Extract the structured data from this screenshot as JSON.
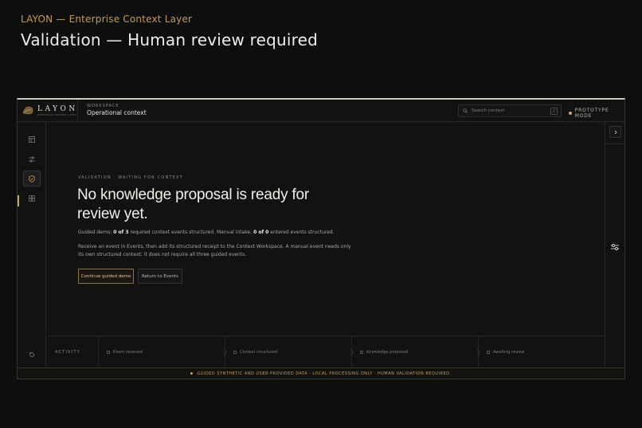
{
  "page": {
    "pretitle": "LAYON — Enterprise Context Layer",
    "title": "Validation — Human review required"
  },
  "topbar": {
    "brand_name": "LAYON",
    "brand_tag": "ENTERPRISE CONTEXT LAYER",
    "workspace_label": "WORKSPACE",
    "workspace_value": "Operational context",
    "search_placeholder": "Search context",
    "search_shortcut": "/",
    "mode_label": "PROTOTYPE MODE"
  },
  "sidebar": {
    "items": [
      {
        "icon": "layout-icon"
      },
      {
        "icon": "sliders-icon"
      },
      {
        "icon": "shield-check-icon",
        "active": true
      },
      {
        "icon": "grid-icon"
      }
    ],
    "bottom_icon": "reset-icon"
  },
  "main": {
    "eyebrow": "VALIDATION · WAITING FOR CONTEXT",
    "headline": "No knowledge proposal is ready for review yet.",
    "status": {
      "prefix": "Guided demo: ",
      "guided_count": "0 of 3",
      "middle": " required context events structured. Manual intake: ",
      "manual_count": "0 of 0",
      "suffix": " entered events structured."
    },
    "description": "Receive an event in Events, then add its structured receipt to the Context Workspace. A manual event needs only its own structured context; it does not require all three guided events.",
    "primary_button": "Continue guided demo",
    "secondary_button": "Return to Events"
  },
  "activity": {
    "label": "ACTIVITY",
    "steps": [
      "Event received",
      "Context structured",
      "Knowledge proposed",
      "Awaiting review"
    ]
  },
  "footer": {
    "text": "GUIDED SYNTHETIC AND USER-PROVIDED DATA · LOCAL PROCESSING ONLY · HUMAN VALIDATION REQUIRED."
  },
  "colors": {
    "accent": "#c9a46a",
    "background": "#0e0e0e",
    "panel": "#121212"
  }
}
